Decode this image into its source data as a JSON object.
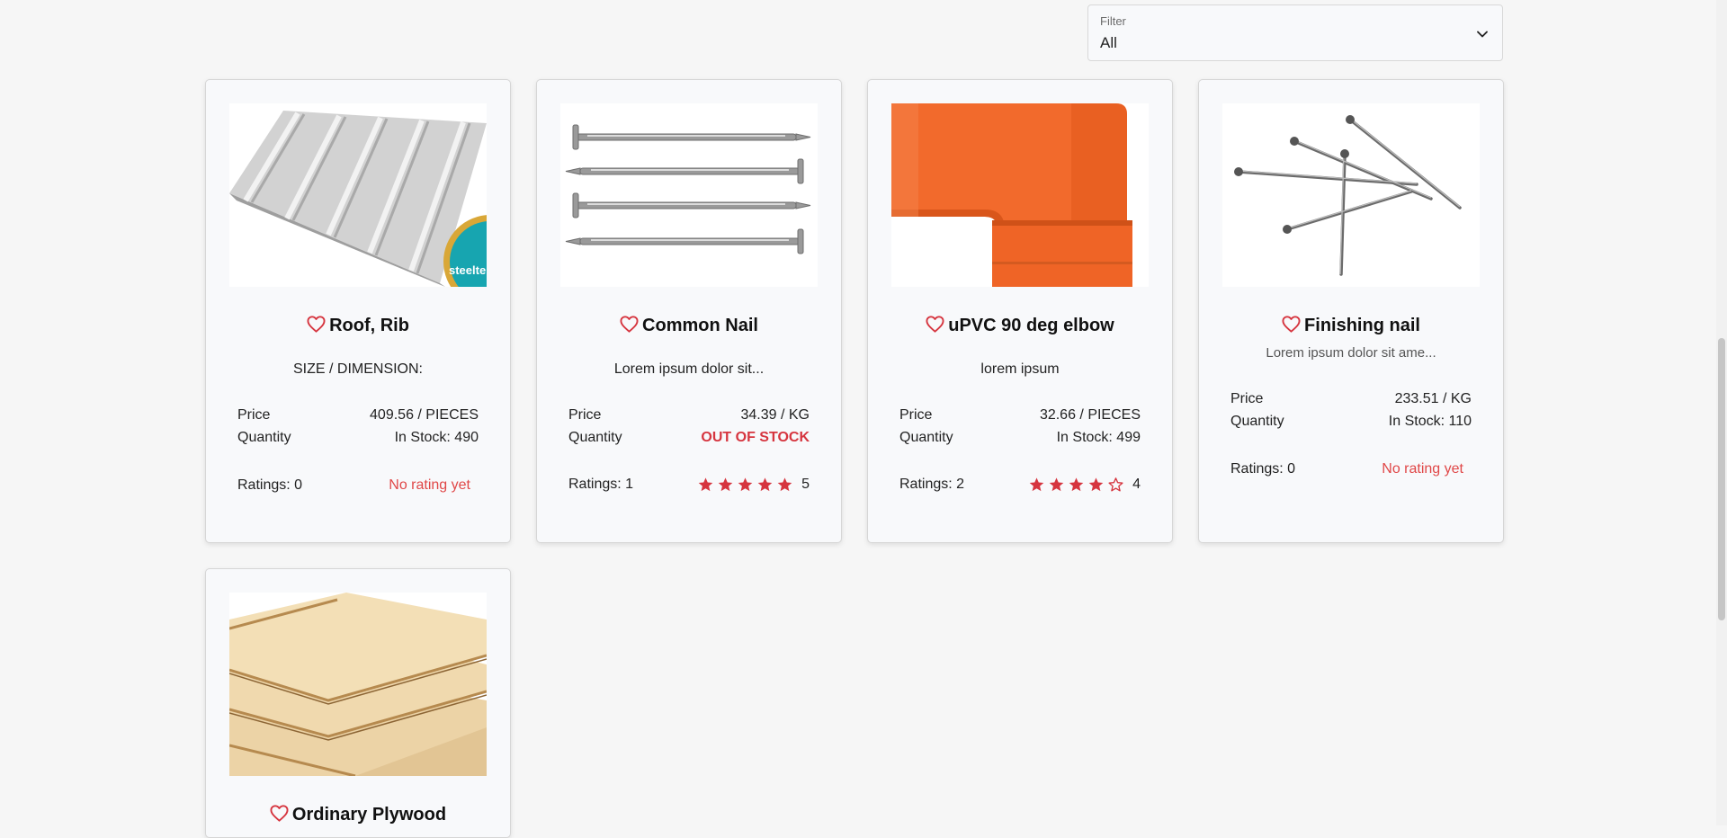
{
  "filter": {
    "label": "Filter",
    "value": "All"
  },
  "labels": {
    "price": "Price",
    "quantity": "Quantity"
  },
  "colors": {
    "accent": "#d6353f",
    "background": "#f6f6f6",
    "card": "#f8f9fb"
  },
  "products": [
    {
      "name": "Roof, Rib",
      "description": "SIZE / DIMENSION:",
      "price": "409.56 / PIECES",
      "quantity": "In Stock: 490",
      "ratings_label": "Ratings: 0",
      "rating_text": "No rating yet",
      "image": "corrugated-roof-sheet",
      "logo_text": "steelte"
    },
    {
      "name": "Common Nail",
      "description": "Lorem ipsum dolor sit...",
      "price": "34.39 / KG",
      "quantity": "OUT OF STOCK",
      "ratings_label": "Ratings: 1",
      "rating_value": "5",
      "image": "common-nails"
    },
    {
      "name": "uPVC 90 deg elbow",
      "description": "lorem ipsum",
      "price": "32.66 / PIECES",
      "quantity": "In Stock: 499",
      "ratings_label": "Ratings: 2",
      "rating_value": "4",
      "image": "orange-pipe-elbow"
    },
    {
      "name": "Finishing nail",
      "description": "Lorem ipsum dolor sit ame...",
      "price": "233.51 / KG",
      "quantity": "In Stock: 110",
      "ratings_label": "Ratings: 0",
      "rating_text": "No rating yet",
      "image": "finishing-nails"
    },
    {
      "name": "Ordinary Plywood",
      "image": "plywood-sheets"
    }
  ]
}
